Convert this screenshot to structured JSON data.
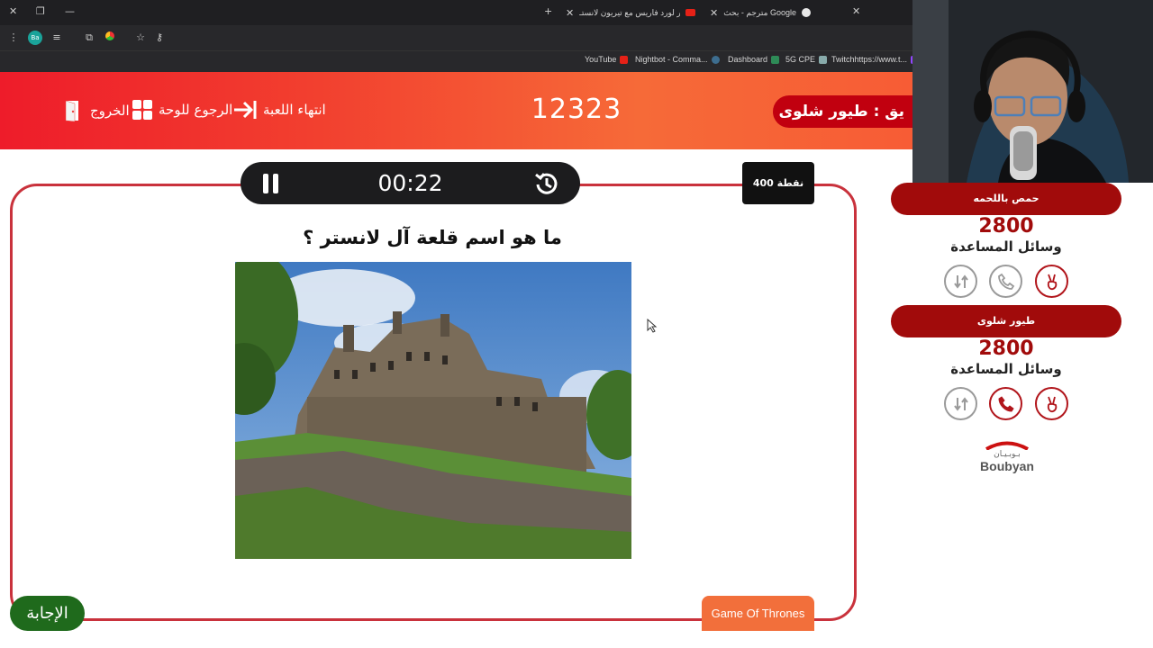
{
  "browser": {
    "tabs": [
      {
        "label": "مترجم - بحث Google"
      },
      {
        "label": "حوار لورد فاريس مع تيريون لانستـ"
      }
    ],
    "bookmarks": [
      "YouTube",
      "Nightbot - Comma...",
      "Dashboard",
      "5G CPE",
      "Twitchhttps://www.t..."
    ],
    "profile_badge": "Ba"
  },
  "header": {
    "exit_label": "الخروج",
    "back_label": "الرجوع للوحة",
    "end_game_label": "انتهاء اللعبة",
    "game_code": "12323",
    "turn_label": "دور فريق : طيور شلوى",
    "turn_label_visible": "يق : طيور شلوى"
  },
  "question": {
    "timer": "00:22",
    "points": "400 نقطة",
    "text": "ما هو اسم قلعة آل لانستر ؟",
    "category": "Game Of Thrones",
    "answer_label": "الإجابة"
  },
  "teams": [
    {
      "name": "حمص باللحمه",
      "score": "2800",
      "helpers_label": "وسائل المساعدة",
      "phone_active": false
    },
    {
      "name": "طيور شلوى",
      "score": "2800",
      "helpers_label": "وسائل المساعدة",
      "phone_active": true
    }
  ],
  "sponsor": {
    "arabic": "بـوبـيـان",
    "english": "Boubyan"
  },
  "colors": {
    "header_red": "#ee1c2a",
    "header_orange": "#f66a38",
    "board_border": "#c9323c",
    "team_red": "#a10b0b",
    "answer_green": "#1f6a1c",
    "category_orange": "#f26f3b"
  }
}
